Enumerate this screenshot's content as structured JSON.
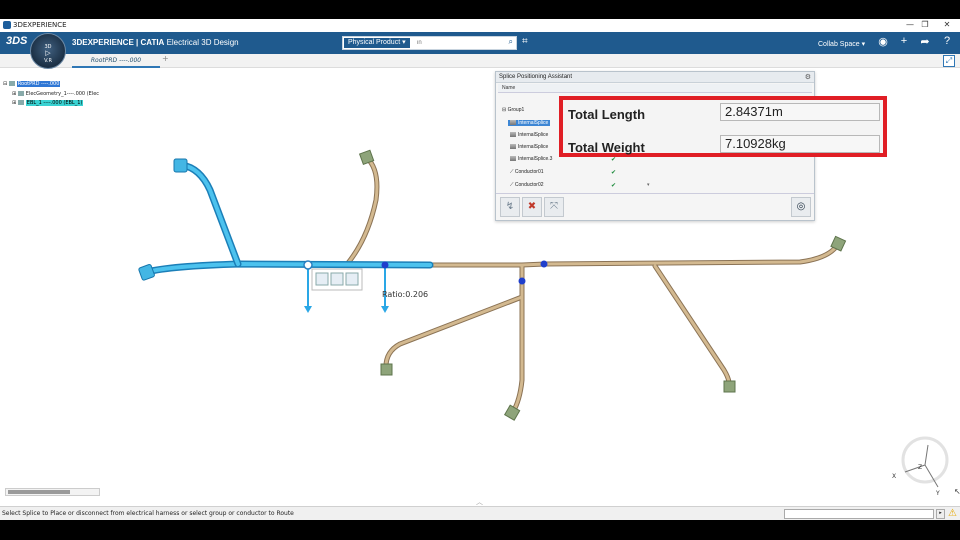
{
  "os_window": {
    "title": "3DEXPERIENCE",
    "minimize": "—",
    "maximize": "❐",
    "close": "✕"
  },
  "header": {
    "logo_text": "3DS",
    "brand": "3DEXPERIENCE | CATIA",
    "app_name": "Electrical 3D Design",
    "compass": {
      "top": "3D",
      "bottom": "V.R"
    },
    "search": {
      "scope": "Physical Product",
      "placeholder": "in"
    },
    "collab_space": "Collab Space"
  },
  "tabs": [
    {
      "label": "RootPRD ----.000"
    }
  ],
  "tree": {
    "root": "RootPRD ----.000",
    "children": [
      "ElecGeometry_1----.000 (Elec",
      "EBL_1 ----.000 (EBL_1)"
    ]
  },
  "splice_panel": {
    "title": "Splice Positioning Assistant",
    "column_name": "Name",
    "rows": [
      {
        "name": "Group1",
        "check": ""
      },
      {
        "name": "InternalSplice",
        "check": "✔",
        "selected": true
      },
      {
        "name": "InternalSplice",
        "check": "✔"
      },
      {
        "name": "InternalSplice",
        "check": "✔"
      },
      {
        "name": "InternalSplice.3",
        "check": "✔"
      },
      {
        "name": "Conductor01",
        "check": "✔"
      },
      {
        "name": "Conductor02",
        "check": "✔"
      }
    ]
  },
  "metrics": {
    "total_length_label": "Total Length",
    "total_length_value": "2.84371m",
    "total_weight_label": "Total Weight",
    "total_weight_value": "7.10928kg"
  },
  "viewport": {
    "ratio_label": "Ratio:0.206"
  },
  "compass_axes": {
    "x": "X",
    "y": "Y",
    "z": "Z"
  },
  "status_bar": {
    "message": "Select Splice to Place or disconnect from electrical harness or select group or conductor to Route"
  },
  "colors": {
    "accent": "#1f5a8e",
    "harness_selected": "#3fb0e4",
    "harness": "#c9ad85",
    "highlight": "#e01e25"
  }
}
